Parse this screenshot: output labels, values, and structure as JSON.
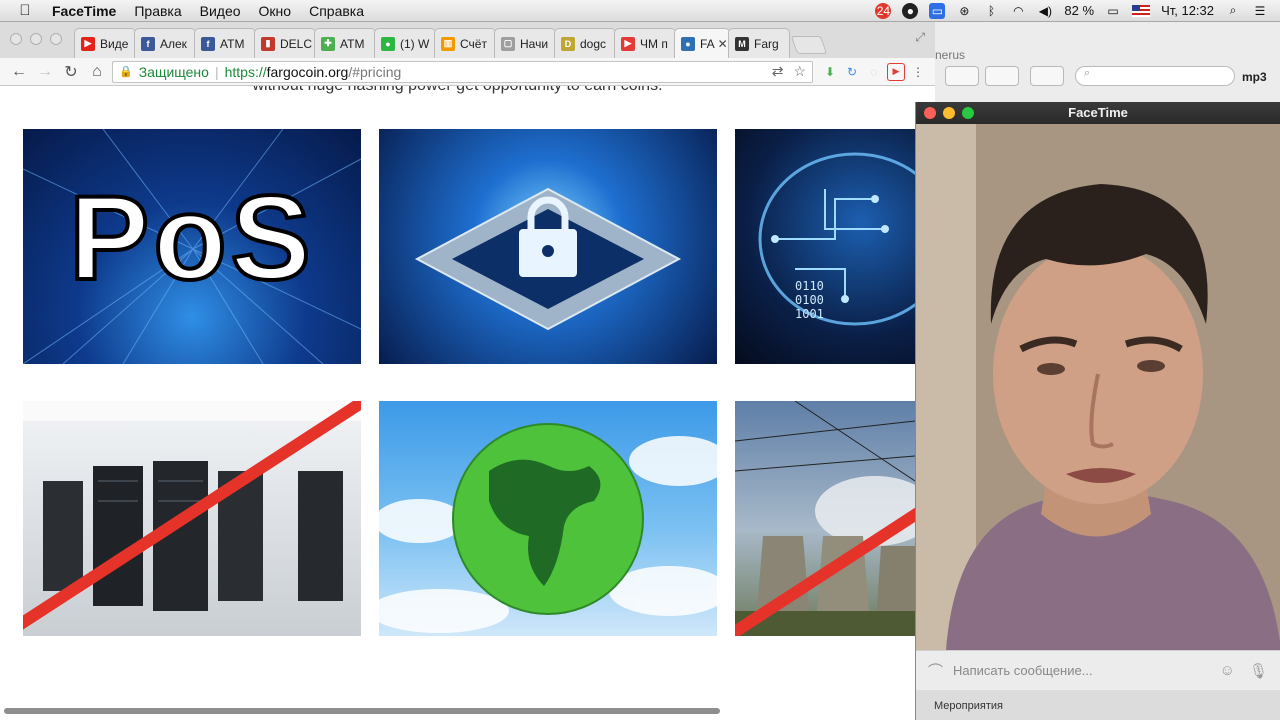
{
  "menubar": {
    "app_name": "FaceTime",
    "items": [
      "Правка",
      "Видео",
      "Окно",
      "Справка"
    ],
    "battery": "82 %",
    "clock": "Чт, 12:32",
    "notification_count": "24"
  },
  "browser": {
    "tabs": [
      {
        "label": "Виде",
        "icon": "youtube-icon",
        "color": "#e62117",
        "glyph": "▶"
      },
      {
        "label": "Алек",
        "icon": "facebook-icon",
        "color": "#3b5998",
        "glyph": "f"
      },
      {
        "label": "ATM",
        "icon": "facebook-icon",
        "color": "#3b5998",
        "glyph": "f"
      },
      {
        "label": "DELC",
        "icon": "delc-icon",
        "color": "#c0392b",
        "glyph": "▮"
      },
      {
        "label": "ATM",
        "icon": "atm-plus-icon",
        "color": "#4caf50",
        "glyph": "✚"
      },
      {
        "label": "(1) W",
        "icon": "whatsapp-icon",
        "color": "#2cb742",
        "glyph": "●"
      },
      {
        "label": "Счёт",
        "icon": "analytics-icon",
        "color": "#f29900",
        "glyph": "▥"
      },
      {
        "label": "Начи",
        "icon": "page-icon",
        "color": "#9e9e9e",
        "glyph": "▢"
      },
      {
        "label": "dogc",
        "icon": "dogecoin-icon",
        "color": "#c2a633",
        "glyph": "D"
      },
      {
        "label": "ЧМ п",
        "icon": "flag-icon",
        "color": "#e53935",
        "glyph": "▶"
      },
      {
        "label": "FA",
        "icon": "fargo-dot-icon",
        "color": "#2f6fb3",
        "glyph": "●",
        "active": true
      },
      {
        "label": "Farg",
        "icon": "fargo-logo-icon",
        "color": "#333333",
        "glyph": "M"
      }
    ],
    "address": {
      "secure_label": "Защищено",
      "scheme": "https://",
      "host": "fargocoin.org",
      "path": "/#pricing"
    }
  },
  "page": {
    "top_text": "without huge hashing power get opportunity to earn coins.",
    "images": [
      {
        "name": "pos-image",
        "text": "PoS"
      },
      {
        "name": "secure-chip-image",
        "text": ""
      },
      {
        "name": "circuit-brain-image",
        "text": "0110\n0100\n1001"
      },
      {
        "name": "server-room-crossed-image",
        "text": ""
      },
      {
        "name": "green-earth-image",
        "text": ""
      },
      {
        "name": "power-plant-crossed-image",
        "text": ""
      }
    ]
  },
  "background_window": {
    "title_fragment": "nerus",
    "search_placeholder": "",
    "mp3_label": "mp3"
  },
  "facetime": {
    "title": "FaceTime",
    "message_placeholder": "Написать сообщение...",
    "footer_text": "Мероприятия"
  }
}
